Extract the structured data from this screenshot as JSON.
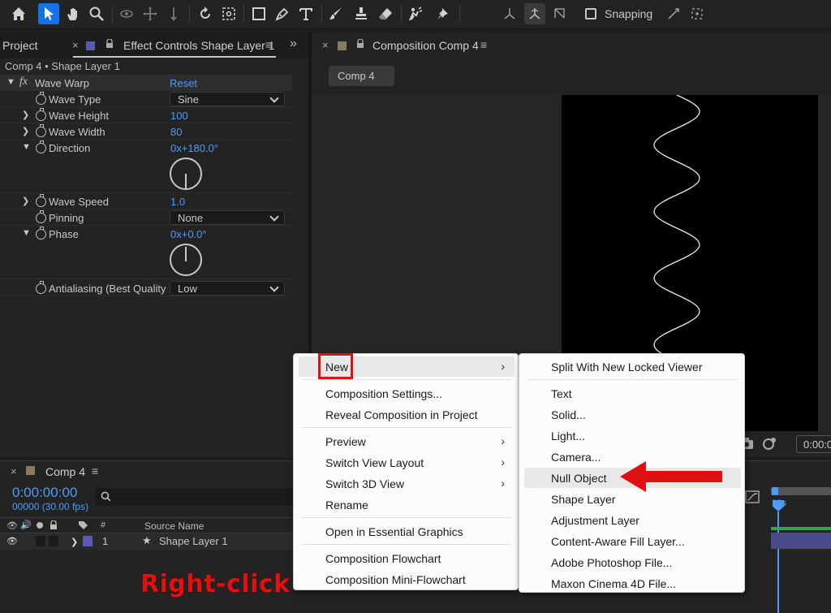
{
  "toolbar": {
    "snapping_label": "Snapping"
  },
  "project_tab": {
    "label": "Project"
  },
  "effect_controls": {
    "tab_label": "Effect Controls Shape Layer 1",
    "path": "Comp 4 • Shape Layer 1",
    "effect_name": "Wave Warp",
    "reset_label": "Reset",
    "wave_type": {
      "label": "Wave Type",
      "value": "Sine"
    },
    "wave_height": {
      "label": "Wave Height",
      "value": "100"
    },
    "wave_width": {
      "label": "Wave Width",
      "value": "80"
    },
    "direction": {
      "label": "Direction",
      "value": "0x+180.0°"
    },
    "wave_speed": {
      "label": "Wave Speed",
      "value": "1.0"
    },
    "pinning": {
      "label": "Pinning",
      "value": "None"
    },
    "phase": {
      "label": "Phase",
      "value": "0x+0.0°"
    },
    "antialiasing": {
      "label": "Antialiasing (Best Quality",
      "value": "Low"
    }
  },
  "composition_panel": {
    "tab_label": "Composition Comp 4",
    "comp_button": "Comp 4",
    "zoom_readout": "0:00:0"
  },
  "timeline": {
    "tab_label": "Comp 4",
    "timecode": "0:00:00:00",
    "fps": "00000 (30.00 fps)",
    "col_hash": "#",
    "col_source_name": "Source Name",
    "layer_number": "1",
    "layer_name": "Shape Layer 1",
    "ruler_label": "10s"
  },
  "context_menu": {
    "items": [
      {
        "label": "New",
        "submenu": true
      },
      {
        "label": "Composition Settings..."
      },
      {
        "label": "Reveal Composition in Project"
      },
      {
        "label": "Preview",
        "submenu": true
      },
      {
        "label": "Switch View Layout",
        "submenu": true
      },
      {
        "label": "Switch 3D View",
        "submenu": true
      },
      {
        "label": "Rename"
      },
      {
        "label": "Open in Essential Graphics"
      },
      {
        "label": "Composition Flowchart"
      },
      {
        "label": "Composition Mini-Flowchart"
      }
    ],
    "arrow_glyph": "›"
  },
  "new_submenu": {
    "items": [
      {
        "label": "Split With New Locked Viewer"
      },
      {
        "label": "Text"
      },
      {
        "label": "Solid..."
      },
      {
        "label": "Light..."
      },
      {
        "label": "Camera..."
      },
      {
        "label": "Null Object"
      },
      {
        "label": "Shape Layer"
      },
      {
        "label": "Adjustment Layer"
      },
      {
        "label": "Content-Aware Fill Layer..."
      },
      {
        "label": "Adobe Photoshop File..."
      },
      {
        "label": "Maxon Cinema 4D File..."
      }
    ]
  },
  "annotation": {
    "text": "Right-click"
  },
  "colors": {
    "accent_blue": "#1473e6",
    "value_blue": "#4d9bf5",
    "annotation_red": "#e01111",
    "layer_label_purple": "#5a5ab4",
    "timeline_green": "#2fa84f"
  }
}
